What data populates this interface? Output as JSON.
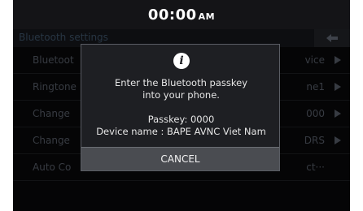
{
  "status": {
    "time": "00:00",
    "ampm": "AM"
  },
  "header": {
    "title": "Bluetooth settings",
    "back_icon": "back-arrow-icon"
  },
  "settings": {
    "rows": [
      {
        "label": "Bluetoot",
        "value": "vice"
      },
      {
        "label": "Ringtone",
        "value": "ne1"
      },
      {
        "label": "Change",
        "value": "000"
      },
      {
        "label": "Change",
        "value": "DRS"
      },
      {
        "label": "Auto Co",
        "value": "ct···"
      }
    ]
  },
  "dialog": {
    "icon": "info-icon",
    "message_line1": "Enter the Bluetooth passkey",
    "message_line2": "into your phone.",
    "passkey": "Passkey: 0000",
    "device_name": "Device name : BAPE AVNC Viet Nam",
    "cancel_label": "CANCEL"
  }
}
